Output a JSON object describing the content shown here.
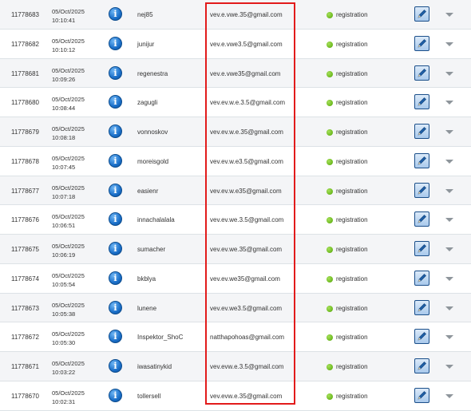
{
  "rows": [
    {
      "id": "11778683",
      "date": "05/Oct/2025",
      "time": "10:10:41",
      "username": "nej85",
      "email": "vev.e.vwe.35@gmail.com",
      "status": "registration"
    },
    {
      "id": "11778682",
      "date": "05/Oct/2025",
      "time": "10:10:12",
      "username": "junijur",
      "email": "vev.e.vwe3.5@gmail.com",
      "status": "registration"
    },
    {
      "id": "11778681",
      "date": "05/Oct/2025",
      "time": "10:09:26",
      "username": "regenestra",
      "email": "vev.e.vwe35@gmail.com",
      "status": "registration"
    },
    {
      "id": "11778680",
      "date": "05/Oct/2025",
      "time": "10:08:44",
      "username": "zagugli",
      "email": "vev.ev.w.e.3.5@gmail.com",
      "status": "registration"
    },
    {
      "id": "11778679",
      "date": "05/Oct/2025",
      "time": "10:08:18",
      "username": "vonnoskov",
      "email": "vev.ev.w.e.35@gmail.com",
      "status": "registration"
    },
    {
      "id": "11778678",
      "date": "05/Oct/2025",
      "time": "10:07:45",
      "username": "moreisgold",
      "email": "vev.ev.w.e3.5@gmail.com",
      "status": "registration"
    },
    {
      "id": "11778677",
      "date": "05/Oct/2025",
      "time": "10:07:18",
      "username": "easienr",
      "email": "vev.ev.w.e35@gmail.com",
      "status": "registration"
    },
    {
      "id": "11778676",
      "date": "05/Oct/2025",
      "time": "10:06:51",
      "username": "innachalalala",
      "email": "vev.ev.we.3.5@gmail.com",
      "status": "registration"
    },
    {
      "id": "11778675",
      "date": "05/Oct/2025",
      "time": "10:06:19",
      "username": "sumacher",
      "email": "vev.ev.we.35@gmail.com",
      "status": "registration"
    },
    {
      "id": "11778674",
      "date": "05/Oct/2025",
      "time": "10:05:54",
      "username": "bkblya",
      "email": "vev.ev.we35@gmail.com",
      "status": "registration"
    },
    {
      "id": "11778673",
      "date": "05/Oct/2025",
      "time": "10:05:38",
      "username": "lunene",
      "email": "vev.ev.we3.5@gmail.com",
      "status": "registration"
    },
    {
      "id": "11778672",
      "date": "05/Oct/2025",
      "time": "10:05:30",
      "username": "Inspektor_ShoC",
      "email": "natthapohoas@gmail.com",
      "status": "registration"
    },
    {
      "id": "11778671",
      "date": "05/Oct/2025",
      "time": "10:03:22",
      "username": "iwasatinykid",
      "email": "vev.evw.e.3.5@gmail.com",
      "status": "registration"
    },
    {
      "id": "11778670",
      "date": "05/Oct/2025",
      "time": "10:02:31",
      "username": "tollersell",
      "email": "vev.evw.e.35@gmail.com",
      "status": "registration"
    }
  ],
  "icons": {
    "info": "info-icon",
    "status": "green-dot-icon",
    "edit": "pencil-edit-icon",
    "expand": "chevron-down-icon"
  },
  "colors": {
    "highlight_border": "#e21b1b",
    "row_alt": "#f4f5f7",
    "status_green": "#6bb81e",
    "info_blue": "#1a6fc9"
  }
}
